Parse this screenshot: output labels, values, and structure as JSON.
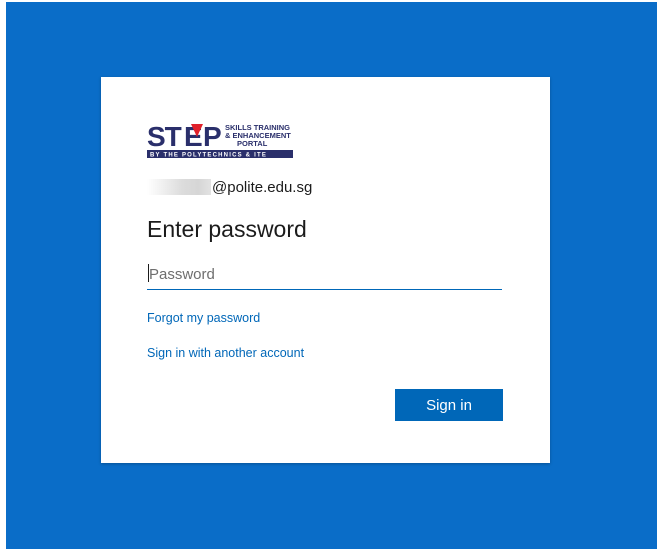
{
  "brand": {
    "logo_wordmark": "STEP",
    "logo_tagline_line1": "SKILLS TRAINING",
    "logo_tagline_line2": "& ENHANCEMENT",
    "logo_tagline_line3": "PORTAL",
    "logo_subtitle": "BY THE POLYTECHNICS & ITE",
    "colors": {
      "navy": "#2a2f6b",
      "red": "#e0202a"
    }
  },
  "login": {
    "identity": "@polite.edu.sg",
    "heading": "Enter password",
    "password_placeholder": "Password",
    "password_value": "",
    "forgot_link": "Forgot my password",
    "other_account_link": "Sign in with another account",
    "signin_button": "Sign in"
  },
  "theme": {
    "background": "#0a6dc8",
    "accent": "#0067b8"
  }
}
